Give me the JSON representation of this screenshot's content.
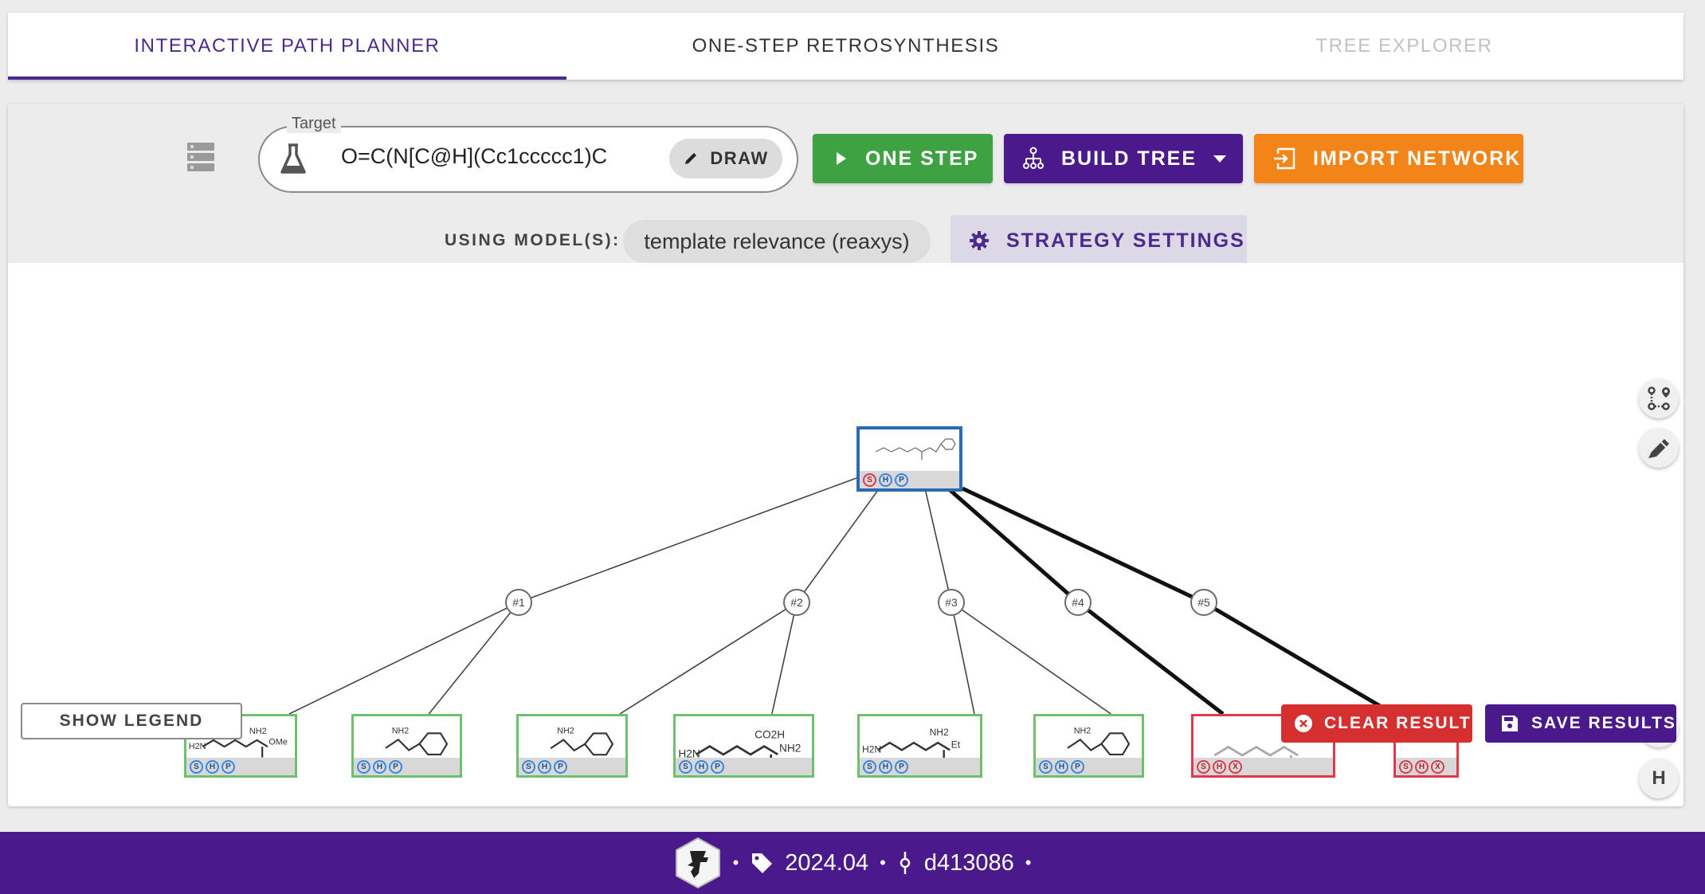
{
  "tabs": [
    {
      "label": "INTERACTIVE PATH PLANNER",
      "state": "active"
    },
    {
      "label": "ONE-STEP RETROSYNTHESIS",
      "state": "normal"
    },
    {
      "label": "TREE EXPLORER",
      "state": "disabled"
    }
  ],
  "toolbar": {
    "target_label": "Target",
    "target_value": "O=C(N[C@H](Cc1ccccc1)C",
    "draw_label": "DRAW",
    "one_step_label": "ONE STEP",
    "build_tree_label": "BUILD TREE",
    "import_label": "IMPORT NETWORK",
    "model_label": "USING MODEL(S):",
    "model_value": "template relevance (reaxys)",
    "strategy_label": "STRATEGY SETTINGS"
  },
  "colors": {
    "accent": "#4a1a8c",
    "one_step": "#3ea142",
    "import": "#f38418",
    "clear": "#d62f30",
    "buyable_border": "#6cc06f",
    "non_buyable_border": "#e0394a",
    "target_border": "#2b6cb0"
  },
  "graph": {
    "target": {
      "id": "target",
      "status": "target",
      "badges": [
        "S",
        "H",
        "P"
      ],
      "badge_colors": [
        "red",
        "blue",
        "blue"
      ]
    },
    "reactions": [
      {
        "label": "#1",
        "highlighted": false
      },
      {
        "label": "#2",
        "highlighted": false
      },
      {
        "label": "#3",
        "highlighted": false
      },
      {
        "label": "#4",
        "highlighted": true
      },
      {
        "label": "#5",
        "highlighted": true
      }
    ],
    "leaves": [
      {
        "reaction": 0,
        "status": "buyable",
        "badges": [
          "S",
          "H",
          "P"
        ],
        "mol_labels": [
          "H2N",
          "NH2",
          "OMe"
        ]
      },
      {
        "reaction": 0,
        "status": "buyable",
        "badges": [
          "S",
          "H",
          "P"
        ],
        "mol_labels": [
          "NH2"
        ]
      },
      {
        "reaction": 1,
        "status": "buyable",
        "badges": [
          "S",
          "H",
          "P"
        ],
        "mol_labels": [
          "NH2"
        ]
      },
      {
        "reaction": 1,
        "status": "buyable",
        "badges": [
          "S",
          "H",
          "P"
        ],
        "mol_labels": [
          "H2N",
          "CO2H",
          "NH2"
        ]
      },
      {
        "reaction": 2,
        "status": "buyable",
        "badges": [
          "S",
          "H",
          "P"
        ],
        "mol_labels": [
          "H2N",
          "NH2",
          "Et"
        ]
      },
      {
        "reaction": 2,
        "status": "buyable",
        "badges": [
          "S",
          "H",
          "P"
        ],
        "mol_labels": [
          "NH2"
        ]
      },
      {
        "reaction": 3,
        "status": "not-buyable",
        "badges": [
          "S",
          "H",
          "X"
        ],
        "mol_labels": []
      },
      {
        "reaction": 4,
        "status": "not-buyable",
        "badges": [
          "S",
          "H",
          "X"
        ],
        "mol_labels": []
      }
    ]
  },
  "side_tools": [
    {
      "name": "route-icon"
    },
    {
      "name": "pencil-icon"
    },
    {
      "name": "camera-icon"
    },
    {
      "name": "hierarchy-toggle",
      "label": "H"
    },
    {
      "name": "fit-screen-icon"
    }
  ],
  "actions": {
    "show_legend": "SHOW LEGEND",
    "clear_result": "CLEAR RESULT",
    "save_results": "SAVE RESULTS"
  },
  "footer": {
    "version": "2024.04",
    "commit": "d413086",
    "separator": "•"
  }
}
